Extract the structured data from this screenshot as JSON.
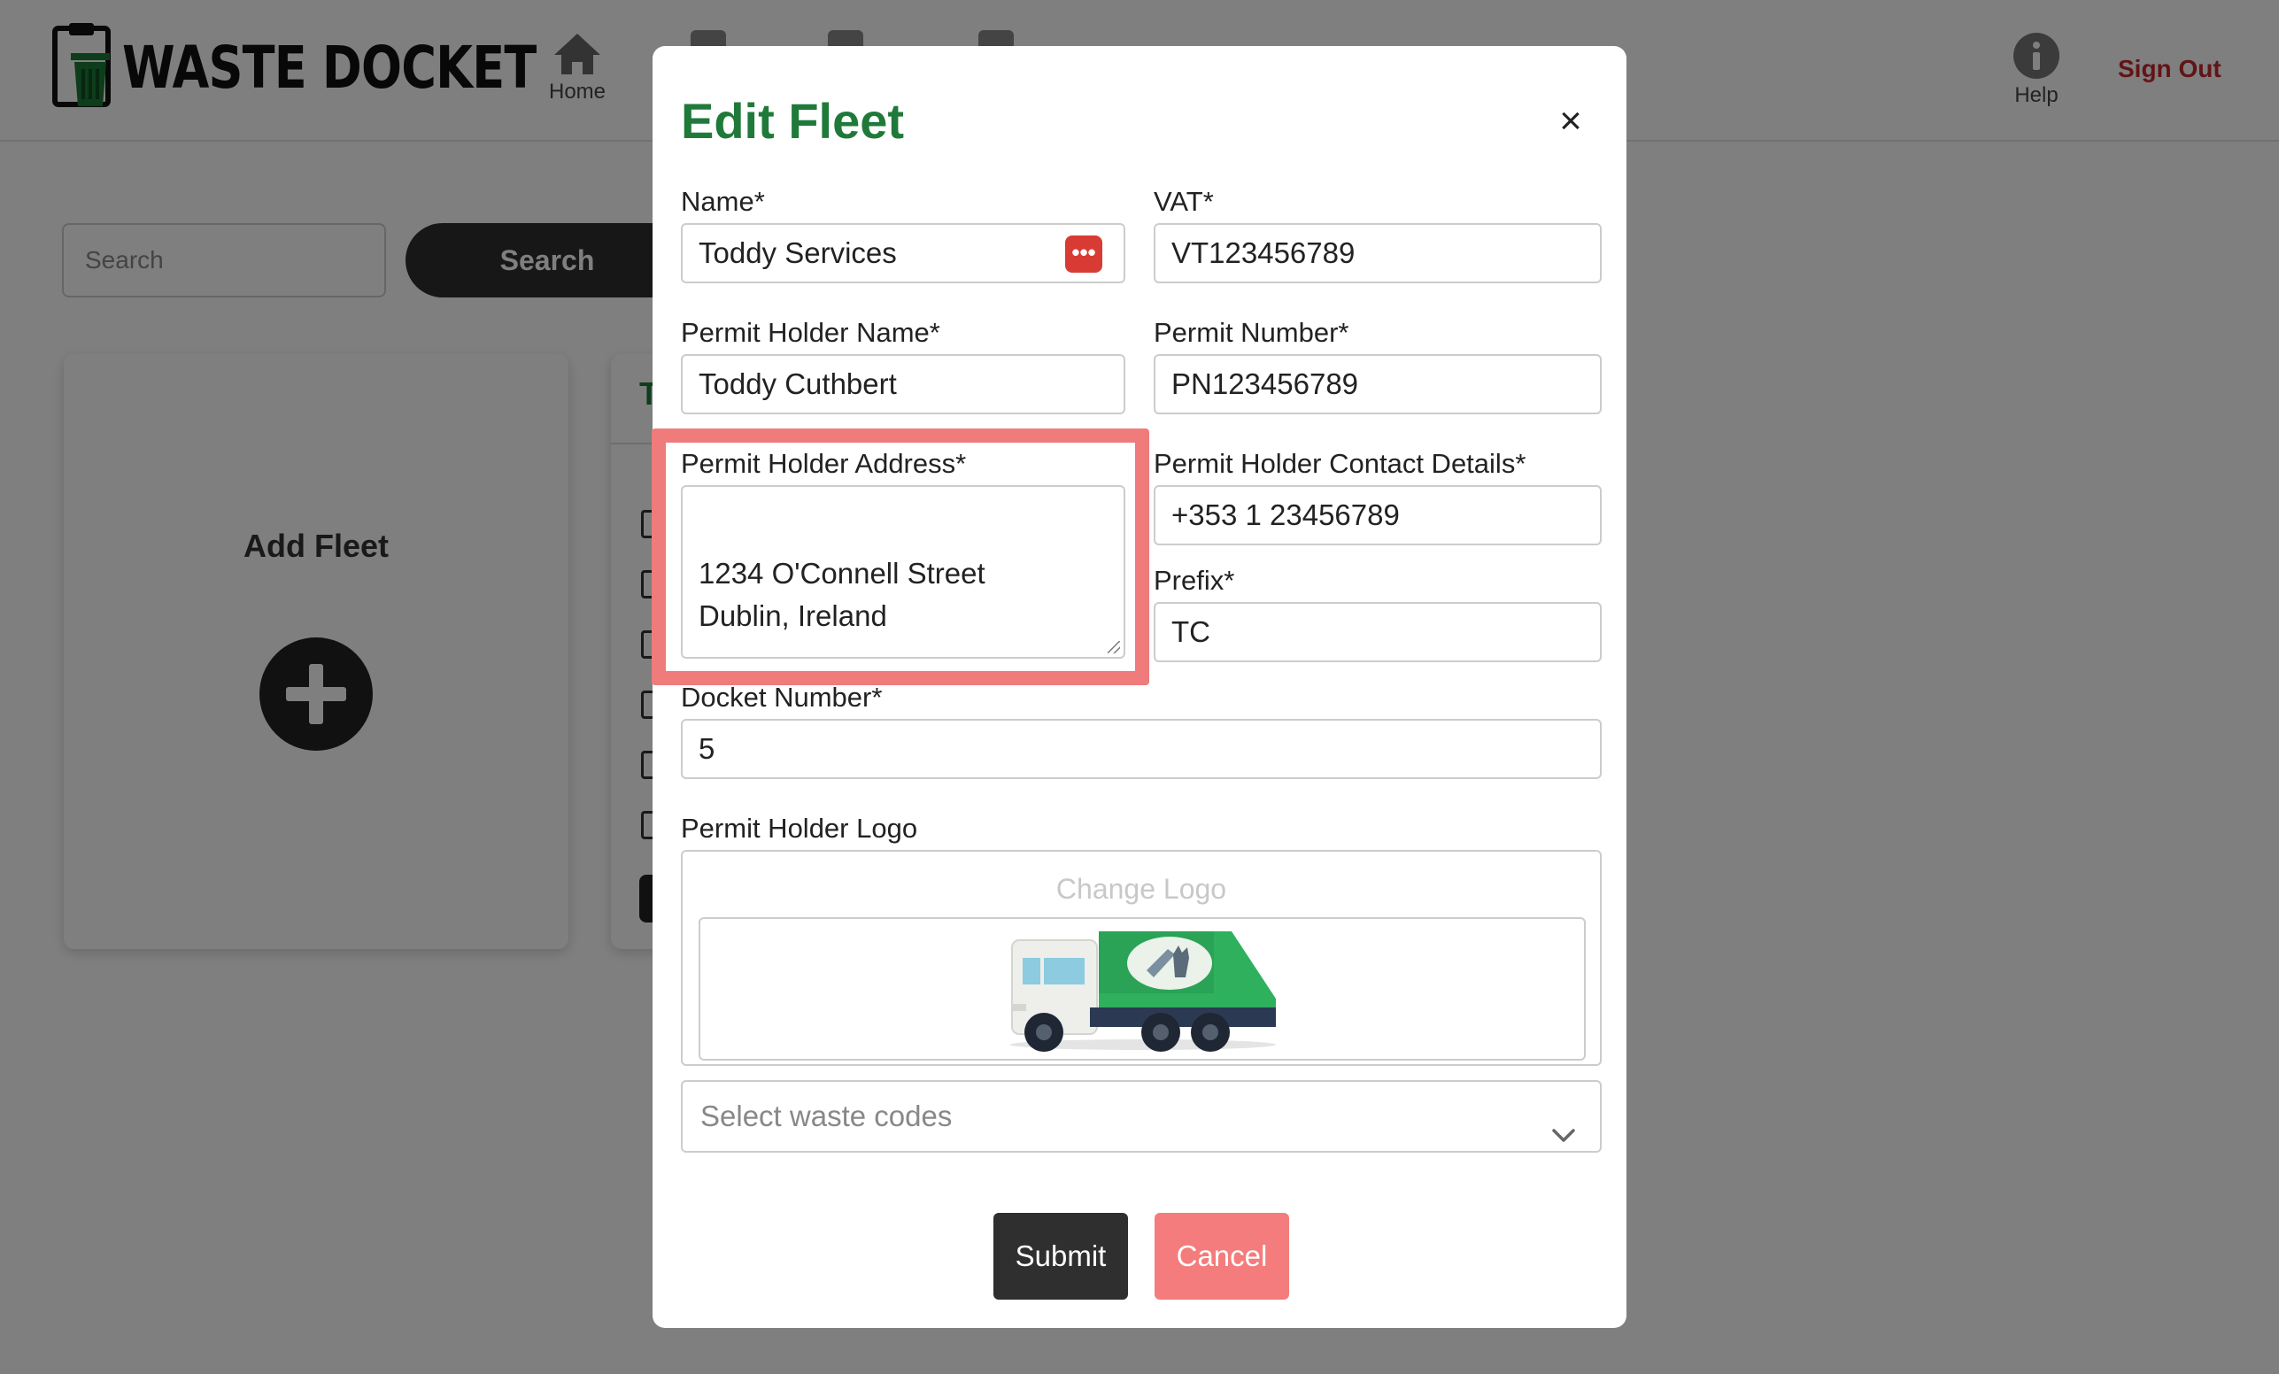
{
  "app": {
    "logo_text": "WASTE DOCKET",
    "nav": {
      "home": "Home",
      "help": "Help",
      "sign_out": "Sign Out"
    }
  },
  "page": {
    "search_placeholder": "Search",
    "search_button": "Search",
    "add_fleet": "Add Fleet",
    "fleet_card_initial": "T"
  },
  "modal": {
    "title": "Edit Fleet",
    "close": "×",
    "fields": {
      "name": {
        "label": "Name*",
        "value": "Toddy Services"
      },
      "vat": {
        "label": "VAT*",
        "value": "VT123456789"
      },
      "permit_holder_name": {
        "label": "Permit Holder Name*",
        "value": "Toddy Cuthbert"
      },
      "permit_number": {
        "label": "Permit Number*",
        "value": "PN123456789"
      },
      "permit_holder_address": {
        "label": "Permit Holder Address*",
        "value": "1234 O'Connell Street\nDublin, Ireland"
      },
      "permit_holder_contact": {
        "label": "Permit Holder Contact Details*",
        "value": "+353 1 23456789"
      },
      "prefix": {
        "label": "Prefix*",
        "value": "TC"
      },
      "docket_number": {
        "label": "Docket Number*",
        "value": "5"
      }
    },
    "logo": {
      "label": "Permit Holder Logo",
      "change_label": "Change Logo"
    },
    "waste_codes": {
      "placeholder": "Select waste codes"
    },
    "buttons": {
      "submit": "Submit",
      "cancel": "Cancel"
    }
  },
  "colors": {
    "brand_green": "#1f7a3a",
    "sign_out_red": "#c6282c",
    "highlight": "#ef7b7b",
    "cancel": "#f47c7c",
    "submit": "#2f2f2f"
  },
  "icons": [
    "trash-bin-logo-icon",
    "home-icon",
    "help-info-icon",
    "close-icon",
    "password-manager-icon",
    "plus-icon",
    "chevron-down-icon",
    "truck-logo-image"
  ]
}
